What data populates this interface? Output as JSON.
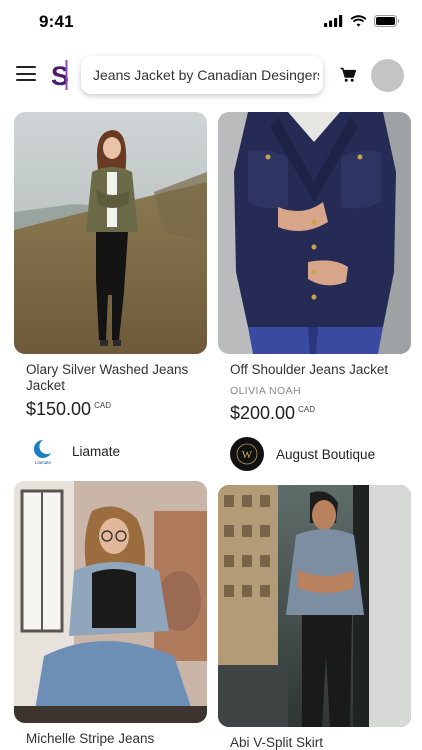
{
  "status": {
    "time": "9:41"
  },
  "header": {
    "search": {
      "value": "Jeans Jacket by Canadian Desingers",
      "placeholder": ""
    },
    "logo_letter": "S",
    "icons": {
      "menu": "hamburger-menu-icon",
      "cart": "shopping-cart-icon",
      "avatar": "profile-avatar"
    }
  },
  "colors": {
    "brand": "#4a1a6b",
    "logo_accent": "#8a4fb2",
    "text": "#222222",
    "muted": "#888888"
  },
  "products": [
    {
      "title": "Olary Silver Washed Jeans Jacket",
      "subtitle": "",
      "price": "$150.00",
      "currency": "CAD",
      "store": {
        "name": "Liamate",
        "logo_text": "Liamate"
      }
    },
    {
      "title": "Off Shoulder Jeans Jacket",
      "subtitle": "OLIVIA NOAH",
      "price": "$200.00",
      "currency": "CAD",
      "store": {
        "name": "August Boutique",
        "logo_text": "W"
      }
    },
    {
      "title": "Michelle Stripe Jeans",
      "subtitle": "",
      "price": "",
      "currency": "",
      "store": {
        "name": "",
        "logo_text": ""
      }
    },
    {
      "title": "Abi V-Split Skirt",
      "subtitle": "",
      "price": "",
      "currency": "",
      "store": {
        "name": "",
        "logo_text": ""
      }
    }
  ]
}
